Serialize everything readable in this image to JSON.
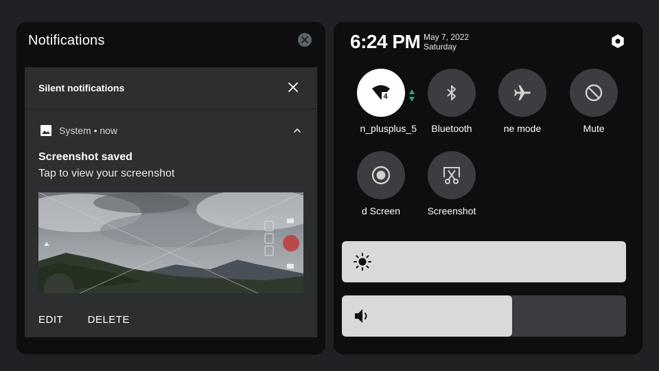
{
  "notifications": {
    "title": "Notifications",
    "silent_header": "Silent notifications",
    "card": {
      "app_line": "System • now",
      "title": "Screenshot saved",
      "text": "Tap to view your screenshot",
      "actions": [
        "EDIT",
        "DELETE"
      ]
    }
  },
  "quick_settings": {
    "time": "6:24 PM",
    "date": "May 7, 2022",
    "day": "Saturday",
    "tiles": [
      {
        "label": "n_plusplus_5",
        "icon": "wifi-icon",
        "active": true,
        "badge": "4"
      },
      {
        "label": "Bluetooth",
        "icon": "bluetooth-icon",
        "active": false
      },
      {
        "label": "ne mode",
        "icon": "airplane-icon",
        "active": false
      },
      {
        "label": "Mute",
        "icon": "mute-icon",
        "active": false
      },
      {
        "label": "d Screen",
        "icon": "record-icon",
        "active": false
      },
      {
        "label": "Screenshot",
        "icon": "screenshot-icon",
        "active": false
      }
    ],
    "brightness": {
      "icon": "brightness-icon",
      "level": 1.0
    },
    "volume": {
      "icon": "volume-icon",
      "level": 0.6
    }
  },
  "colors": {
    "background": "#202124",
    "panel": "#0e0e0f",
    "card": "#2d2e30",
    "tile": "#3c3d40",
    "slider_fill": "#d9d9d9"
  }
}
